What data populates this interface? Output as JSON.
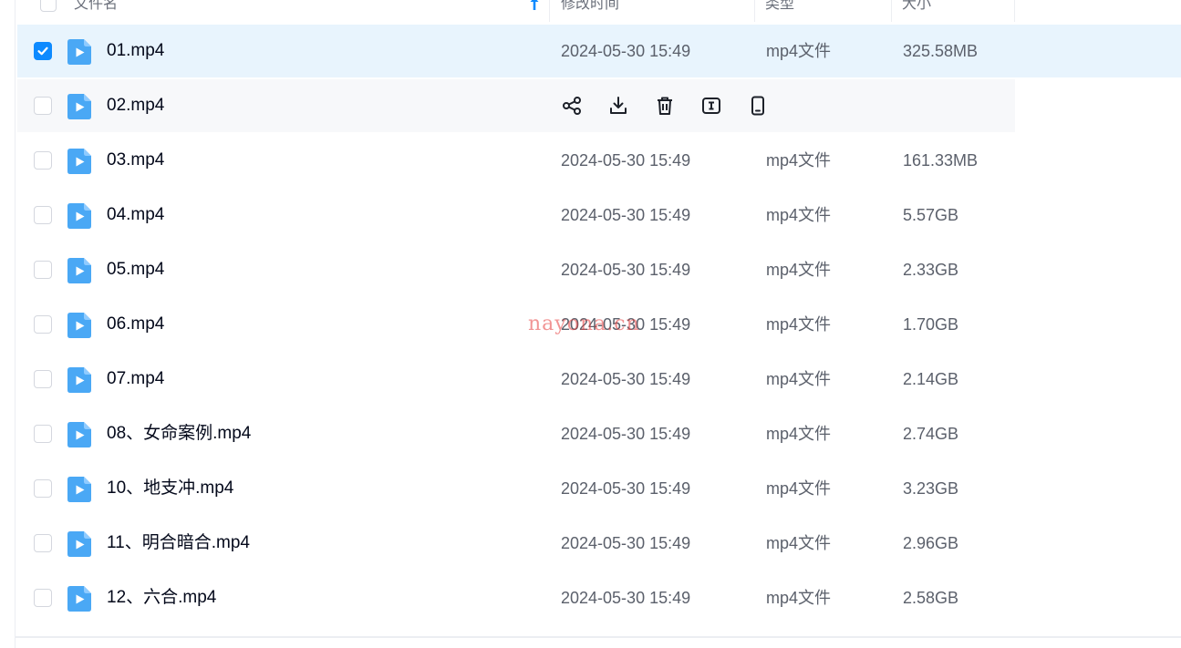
{
  "header": {
    "name_label": "文件名",
    "modified_label": "修改时间",
    "type_label": "类型",
    "size_label": "大小"
  },
  "accent_color": "#0d8aff",
  "file_icon": "video-file-icon",
  "hover_actions": [
    "share-icon",
    "download-icon",
    "delete-icon",
    "rename-icon",
    "mobile-icon"
  ],
  "files": [
    {
      "name": "01.mp4",
      "modified": "2024-05-30 15:49",
      "type": "mp4文件",
      "size": "325.58MB",
      "checked": true
    },
    {
      "name": "02.mp4",
      "modified": "",
      "type": "",
      "size": "",
      "checked": false,
      "hover": true
    },
    {
      "name": "03.mp4",
      "modified": "2024-05-30 15:49",
      "type": "mp4文件",
      "size": "161.33MB",
      "checked": false
    },
    {
      "name": "04.mp4",
      "modified": "2024-05-30 15:49",
      "type": "mp4文件",
      "size": "5.57GB",
      "checked": false
    },
    {
      "name": "05.mp4",
      "modified": "2024-05-30 15:49",
      "type": "mp4文件",
      "size": "2.33GB",
      "checked": false
    },
    {
      "name": "06.mp4",
      "modified": "2024-05-30 15:49",
      "type": "mp4文件",
      "size": "1.70GB",
      "checked": false
    },
    {
      "name": "07.mp4",
      "modified": "2024-05-30 15:49",
      "type": "mp4文件",
      "size": "2.14GB",
      "checked": false
    },
    {
      "name": "08、女命案例.mp4",
      "modified": "2024-05-30 15:49",
      "type": "mp4文件",
      "size": "2.74GB",
      "checked": false
    },
    {
      "name": "10、地支冲.mp4",
      "modified": "2024-05-30 15:49",
      "type": "mp4文件",
      "size": "3.23GB",
      "checked": false
    },
    {
      "name": "11、明合暗合.mp4",
      "modified": "2024-05-30 15:49",
      "type": "mp4文件",
      "size": "2.96GB",
      "checked": false
    },
    {
      "name": "12、六合.mp4",
      "modified": "2024-05-30 15:49",
      "type": "mp4文件",
      "size": "2.58GB",
      "checked": false
    }
  ],
  "watermark": "nayona.cn"
}
